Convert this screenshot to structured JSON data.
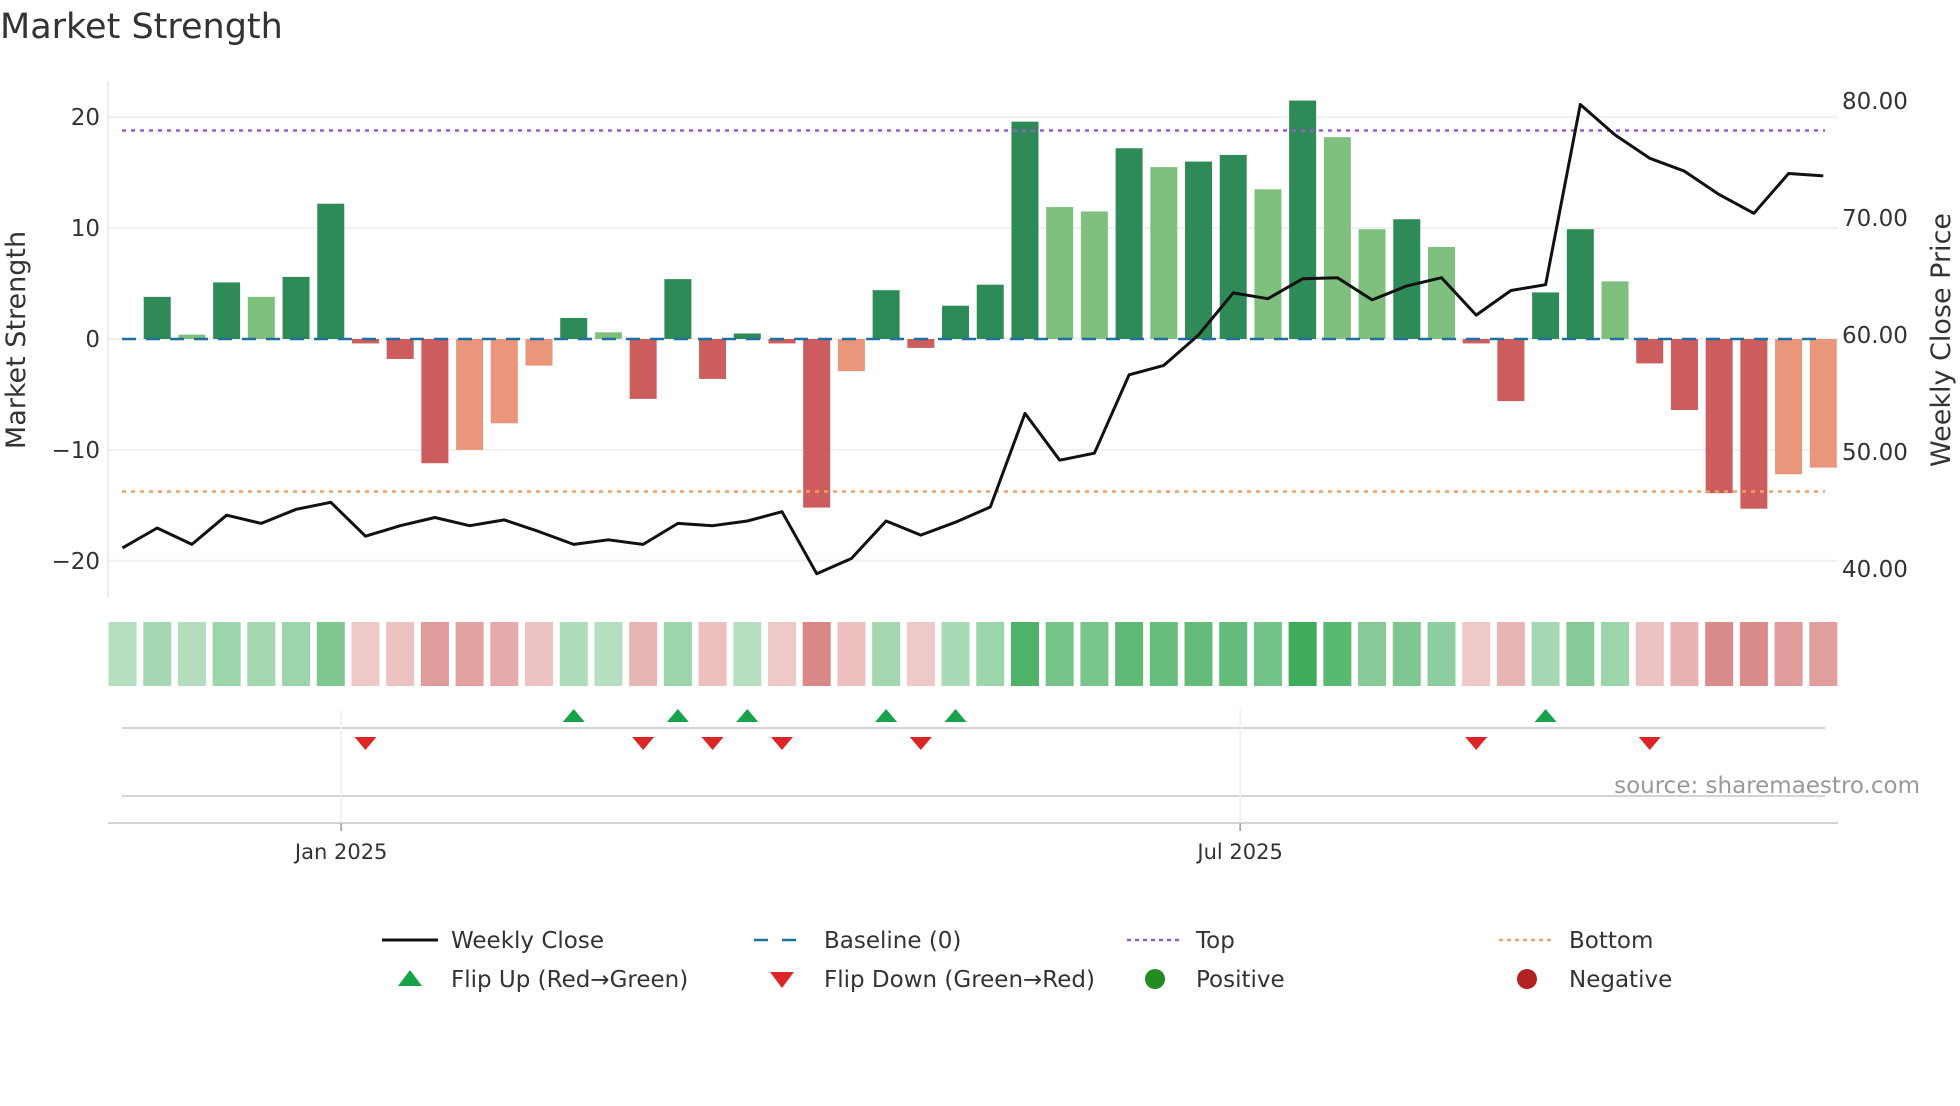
{
  "title": "Market Strength",
  "source": "source: sharemaestro.com",
  "colors": {
    "strong_pos": "#2e8b57",
    "weak_pos": "#7fc07e",
    "strong_neg": "#cd5c5c",
    "weak_neg": "#e9967a",
    "baseline": "#1f6f9f",
    "top": "#9b59d0",
    "bottom": "#f0a060",
    "flip_up": "#16a34a",
    "flip_down": "#dc2626",
    "positive": "#228b22",
    "negative": "#b22222",
    "line": "#111111"
  },
  "chart_data": {
    "type": "bar+line",
    "title": "Market Strength",
    "ylabel": "Market Strength",
    "y2label": "Weekly Close Price",
    "ylim": [
      -23.5,
      23.5
    ],
    "y2lim": [
      38,
      82
    ],
    "yticks": [
      "20",
      "10",
      "0",
      "−10",
      "−20"
    ],
    "ytick_values": [
      20,
      10,
      0,
      -10,
      -20
    ],
    "y2ticks": [
      "80.00",
      "70.00",
      "60.00",
      "50.00",
      "40.00"
    ],
    "y2tick_values": [
      80,
      70,
      60,
      50,
      40
    ],
    "xticks": [
      {
        "label": "Jan 2025",
        "week": 6.3
      },
      {
        "label": "Jul 2025",
        "week": 32.2
      }
    ],
    "top_level": 18.8,
    "bottom_level": -13.75,
    "baseline": 0,
    "strength": [
      null,
      3.8,
      0.4,
      5.1,
      3.8,
      5.6,
      12.2,
      -0.4,
      -1.8,
      -11.2,
      -10.0,
      -7.6,
      -2.4,
      1.9,
      0.6,
      -5.4,
      5.4,
      -3.6,
      0.5,
      -0.4,
      -15.2,
      -2.9,
      4.4,
      -0.8,
      3.0,
      4.9,
      19.6,
      11.9,
      11.5,
      17.2,
      15.5,
      16.0,
      16.6,
      13.5,
      21.5,
      18.2,
      9.9,
      10.8,
      8.3,
      -0.4,
      -5.6,
      4.2,
      9.9,
      5.2,
      -2.2,
      -6.4,
      -13.9,
      -15.3,
      -12.2,
      -11.6
    ],
    "tone": [
      "",
      "s",
      "w",
      "s",
      "w",
      "s",
      "s",
      "s",
      "s",
      "s",
      "w",
      "w",
      "w",
      "s",
      "w",
      "s",
      "s",
      "s",
      "s",
      "s",
      "s",
      "w",
      "s",
      "s",
      "s",
      "s",
      "s",
      "w",
      "w",
      "s",
      "w",
      "s",
      "s",
      "w",
      "s",
      "w",
      "w",
      "s",
      "w",
      "s",
      "s",
      "s",
      "s",
      "w",
      "s",
      "s",
      "s",
      "s",
      "w",
      "w"
    ],
    "close": [
      41.8,
      43.5,
      42.1,
      44.6,
      43.9,
      45.1,
      45.7,
      42.8,
      43.7,
      44.4,
      43.7,
      44.2,
      43.2,
      42.1,
      42.5,
      42.1,
      43.9,
      43.7,
      44.1,
      44.9,
      39.6,
      40.9,
      44.1,
      42.9,
      44.0,
      45.3,
      53.3,
      49.3,
      49.9,
      56.6,
      57.4,
      60.0,
      63.6,
      63.1,
      64.8,
      64.9,
      63.0,
      64.2,
      64.9,
      61.7,
      63.8,
      64.3,
      79.7,
      77.1,
      75.1,
      74.0,
      72.0,
      70.4,
      73.8,
      73.6
    ],
    "heat": [
      0.2,
      0.3,
      0.22,
      0.35,
      0.32,
      0.35,
      0.55,
      -0.15,
      -0.2,
      -0.5,
      -0.45,
      -0.38,
      -0.2,
      0.25,
      0.2,
      -0.3,
      0.35,
      -0.22,
      0.2,
      -0.15,
      -0.65,
      -0.22,
      0.32,
      -0.15,
      0.28,
      0.35,
      0.85,
      0.6,
      0.58,
      0.75,
      0.7,
      0.72,
      0.72,
      0.62,
      0.95,
      0.78,
      0.5,
      0.55,
      0.45,
      -0.15,
      -0.3,
      0.3,
      0.5,
      0.35,
      -0.2,
      -0.32,
      -0.62,
      -0.62,
      -0.5,
      -0.48
    ],
    "flip_up_weeks": [
      13,
      16,
      18,
      22,
      24,
      41
    ],
    "flip_down_weeks": [
      7,
      15,
      17,
      19,
      23,
      39,
      44
    ],
    "legend": [
      {
        "label": "Weekly Close",
        "kind": "line"
      },
      {
        "label": "Baseline (0)",
        "kind": "dash"
      },
      {
        "label": "Top",
        "kind": "dot-top"
      },
      {
        "label": "Bottom",
        "kind": "dot-bottom"
      },
      {
        "label": "Flip Up (Red→Green)",
        "kind": "tri-up"
      },
      {
        "label": "Flip Down (Green→Red)",
        "kind": "tri-down"
      },
      {
        "label": "Positive",
        "kind": "circle-pos"
      },
      {
        "label": "Negative",
        "kind": "circle-neg"
      }
    ],
    "legend_position": "bottom"
  }
}
